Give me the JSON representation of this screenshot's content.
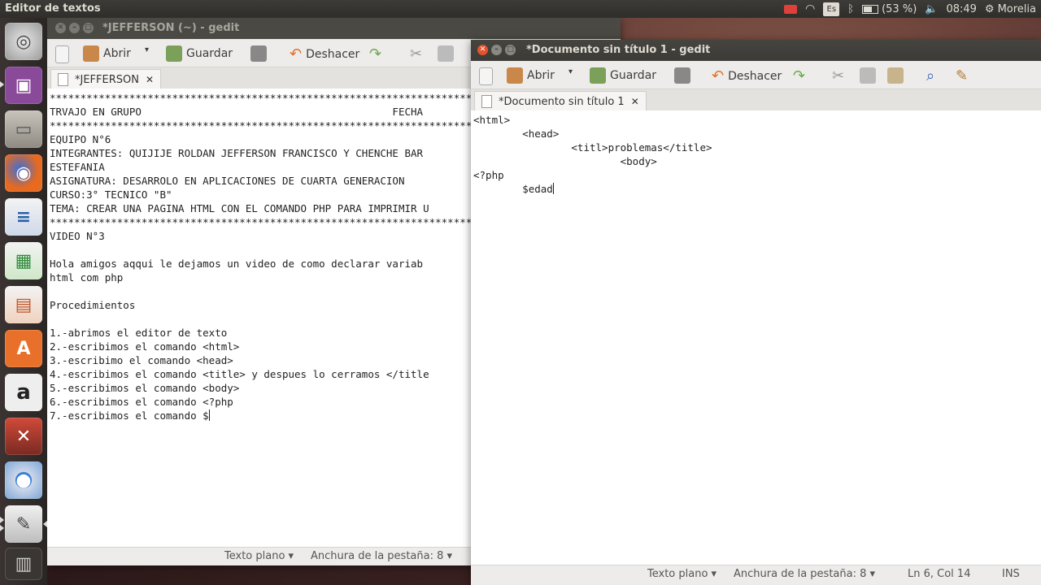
{
  "top_panel": {
    "title": "Editor de textos",
    "battery": "(53 %)",
    "keyboard": "Es",
    "time": "08:49",
    "user": "Morelia"
  },
  "launcher": {
    "icons": [
      "ubuntu-dash-icon",
      "video-icon",
      "files-icon",
      "firefox-icon",
      "writer-icon",
      "calc-icon",
      "impress-icon",
      "software-center-icon",
      "amazon-icon",
      "settings-icon",
      "chromium-icon",
      "gedit-icon",
      "trash-icon"
    ]
  },
  "window1": {
    "title": "*JEFFERSON (~) - gedit",
    "tab": "*JEFFERSON",
    "toolbar": {
      "open": "Abrir",
      "save": "Guardar",
      "undo": "Deshacer"
    },
    "lines": [
      "*******************************************************************************************",
      "TRVAJO EN GRUPO                                         FECHA",
      "*******************************************************************************************",
      "EQUIPO N°6",
      "INTEGRANTES: QUIJIJE ROLDAN JEFFERSON FRANCISCO Y CHENCHE BAR",
      "ESTEFANIA",
      "ASIGNATURA: DESARROLO EN APLICACIONES DE CUARTA GENERACION",
      "CURSO:3° TECNICO \"B\"",
      "TEMA: CREAR UNA PAGINA HTML CON EL COMANDO PHP PARA IMPRIMIR U",
      "*******************************************************************************************",
      "VIDEO N°3",
      "",
      "Hola amigos aqqui le dejamos un video de como declarar variab",
      "html com php",
      "",
      "Procedimientos",
      "",
      "1.-abrimos el editor de texto",
      "2.-escribimos el comando <html>",
      "3.-escribimo el comando <head>",
      "4.-escribimos el comando <title> y despues lo cerramos </title",
      "5.-escribimos el comando <body>",
      "6.-escribimos el comando <?php",
      "7.-escribimos el comando $"
    ],
    "status": {
      "lang": "Texto plano ▾",
      "tab_width": "Anchura de la pestaña: 8 ▾"
    }
  },
  "window2": {
    "title": "*Documento sin título 1 - gedit",
    "tab": "*Documento sin título 1",
    "toolbar": {
      "open": "Abrir",
      "save": "Guardar",
      "undo": "Deshacer"
    },
    "lines": [
      "<html>",
      "        <head>",
      "                <titl>problemas</title>",
      "                        <body>",
      "<?php",
      "        $edad"
    ],
    "status": {
      "lang": "Texto plano ▾",
      "tab_width": "Anchura de la pestaña: 8 ▾",
      "position": "Ln 6, Col 14",
      "mode": "INS"
    }
  },
  "colors": {
    "accent": "#f07746",
    "panel": "#3c3b37"
  }
}
